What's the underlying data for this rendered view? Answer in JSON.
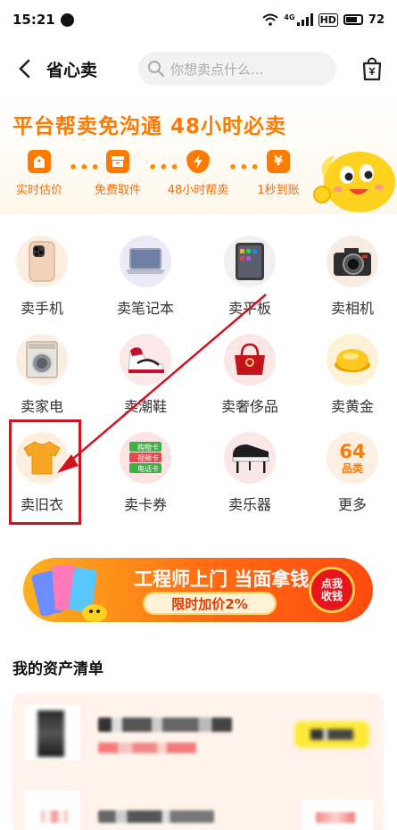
{
  "status_bar": {
    "time": "15:21",
    "network": "4G",
    "hd": "HD",
    "battery": "72"
  },
  "header": {
    "title": "省心卖",
    "search_placeholder": "你想卖点什么..."
  },
  "banner": {
    "slogan": "平台帮卖免沟通  48小时必卖",
    "steps": [
      {
        "label": "实时估价",
        "icon": "price-tag-icon"
      },
      {
        "label": "免费取件",
        "icon": "box-icon"
      },
      {
        "label": "48小时帮卖",
        "icon": "lightning-icon"
      },
      {
        "label": "1秒到账",
        "icon": "yen-icon"
      }
    ],
    "step_yen_glyph": "¥",
    "dots": "•••"
  },
  "categories": [
    {
      "label": "卖手机",
      "icon": "phone-icon"
    },
    {
      "label": "卖笔记本",
      "icon": "laptop-icon"
    },
    {
      "label": "卖平板",
      "icon": "tablet-icon"
    },
    {
      "label": "卖相机",
      "icon": "camera-icon"
    },
    {
      "label": "卖家电",
      "icon": "washing-machine-icon"
    },
    {
      "label": "卖潮鞋",
      "icon": "sneaker-icon"
    },
    {
      "label": "卖奢侈品",
      "icon": "handbag-icon"
    },
    {
      "label": "卖黄金",
      "icon": "gold-icon"
    },
    {
      "label": "卖旧衣",
      "icon": "tshirt-icon"
    },
    {
      "label": "卖卡券",
      "icon": "card-icon"
    },
    {
      "label": "卖乐器",
      "icon": "piano-icon"
    },
    {
      "label": "更多",
      "icon": "more-icon"
    }
  ],
  "more_badge": {
    "count": "64",
    "unit": "品类"
  },
  "card_labels": [
    "购物卡",
    "视频卡",
    "电话卡"
  ],
  "promo": {
    "title": "工程师上门 当面拿钱",
    "tag": "限时加价2%",
    "cta_line1": "点我",
    "cta_line2": "收钱"
  },
  "assets": {
    "title": "我的资产清单"
  },
  "colors": {
    "accent": "#ff7a00",
    "highlight": "#d0131e",
    "arrow": "#d0131e"
  }
}
